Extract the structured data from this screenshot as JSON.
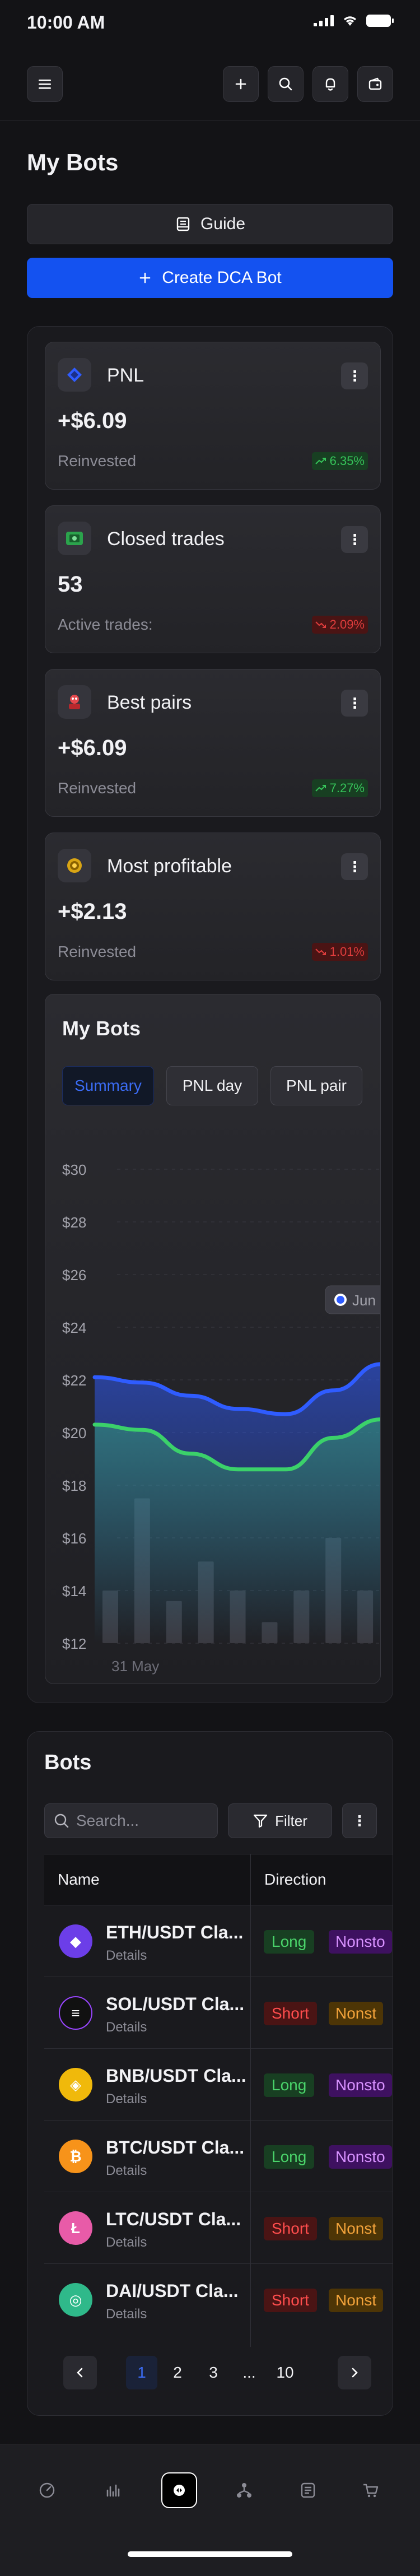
{
  "status": {
    "time": "10:00 AM"
  },
  "header": {
    "menu_icon": "menu-icon",
    "add_icon": "plus-icon",
    "search_icon": "search-icon",
    "bell_icon": "bell-icon",
    "wallet_icon": "wallet-icon"
  },
  "page": {
    "title": "My Bots"
  },
  "actions": {
    "guide_label": "Guide",
    "create_label": "Create DCA Bot"
  },
  "stats": [
    {
      "title": "PNL",
      "value": "+$6.09",
      "sub": "Reinvested",
      "badge": "6.35%",
      "trend": "up",
      "icon": "diamond-icon"
    },
    {
      "title": "Closed trades",
      "value": "53",
      "sub": "Active trades:",
      "badge": "2.09%",
      "trend": "down",
      "icon": "cash-icon"
    },
    {
      "title": "Best pairs",
      "value": "+$6.09",
      "sub": "Reinvested",
      "badge": "7.27%",
      "trend": "up",
      "icon": "robot-icon"
    },
    {
      "title": "Most profitable",
      "value": "+$2.13",
      "sub": "Reinvested",
      "badge": "1.01%",
      "trend": "down",
      "icon": "gear-coin-icon"
    }
  ],
  "chart_card": {
    "title": "My Bots",
    "tabs": [
      "Summary",
      "PNL day",
      "PNL pair"
    ],
    "active_tab": "Summary",
    "tooltip_label": "Jun"
  },
  "chart_data": {
    "type": "line",
    "title": "",
    "ylabel": "",
    "ylim": [
      12,
      30
    ],
    "yticks": [
      "$30",
      "$28",
      "$26",
      "$24",
      "$22",
      "$20",
      "$18",
      "$16",
      "$14",
      "$12"
    ],
    "x_start_label": "31 May",
    "series": [
      {
        "color": "#2f5cff",
        "values": [
          22.1,
          21.9,
          21.4,
          20.9,
          20.7,
          21.6,
          22.6
        ]
      },
      {
        "color": "#3bd16a",
        "values": [
          20.3,
          20.1,
          19.2,
          18.6,
          18.6,
          19.8,
          20.5
        ]
      }
    ],
    "bars": [
      14.0,
      17.5,
      13.6,
      15.1,
      14.0,
      12.8,
      14.0,
      16.0,
      14.0
    ]
  },
  "bots": {
    "title": "Bots",
    "search_placeholder": "Search...",
    "filter_label": "Filter",
    "columns": [
      "Name",
      "Direction"
    ],
    "rows": [
      {
        "pair": "ETH/USDT Cla...",
        "details": "Details",
        "direction": "Long",
        "mode": "Nonsto",
        "coin_color": "#6c3ee8",
        "coin_glyph": "◆",
        "mode_color": "purple",
        "dir_class": "long"
      },
      {
        "pair": "SOL/USDT Cla...",
        "details": "Details",
        "direction": "Short",
        "mode": "Nonst",
        "coin_color": "#111111",
        "coin_glyph": "≡",
        "mode_color": "amber",
        "dir_class": "short"
      },
      {
        "pair": "BNB/USDT Cla...",
        "details": "Details",
        "direction": "Long",
        "mode": "Nonsto",
        "coin_color": "#f0b90b",
        "coin_glyph": "◈",
        "mode_color": "purple",
        "dir_class": "long"
      },
      {
        "pair": "BTC/USDT Cla...",
        "details": "Details",
        "direction": "Long",
        "mode": "Nonsto",
        "coin_color": "#f7931a",
        "coin_glyph": "₿",
        "mode_color": "purple",
        "dir_class": "long"
      },
      {
        "pair": "LTC/USDT Cla...",
        "details": "Details",
        "direction": "Short",
        "mode": "Nonst",
        "coin_color": "#e85ba8",
        "coin_glyph": "Ł",
        "mode_color": "amber",
        "dir_class": "short"
      },
      {
        "pair": "DAI/USDT Cla...",
        "details": "Details",
        "direction": "Short",
        "mode": "Nonst",
        "coin_color": "#2fb98a",
        "coin_glyph": "◎",
        "mode_color": "amber",
        "dir_class": "short"
      }
    ],
    "pagination": {
      "pages": [
        "1",
        "2",
        "3",
        "...",
        "10"
      ],
      "current": "1"
    }
  },
  "bottom_nav": [
    "speedometer-icon",
    "bar-chart-icon",
    "bot-icon",
    "network-icon",
    "list-icon",
    "cart-icon"
  ]
}
